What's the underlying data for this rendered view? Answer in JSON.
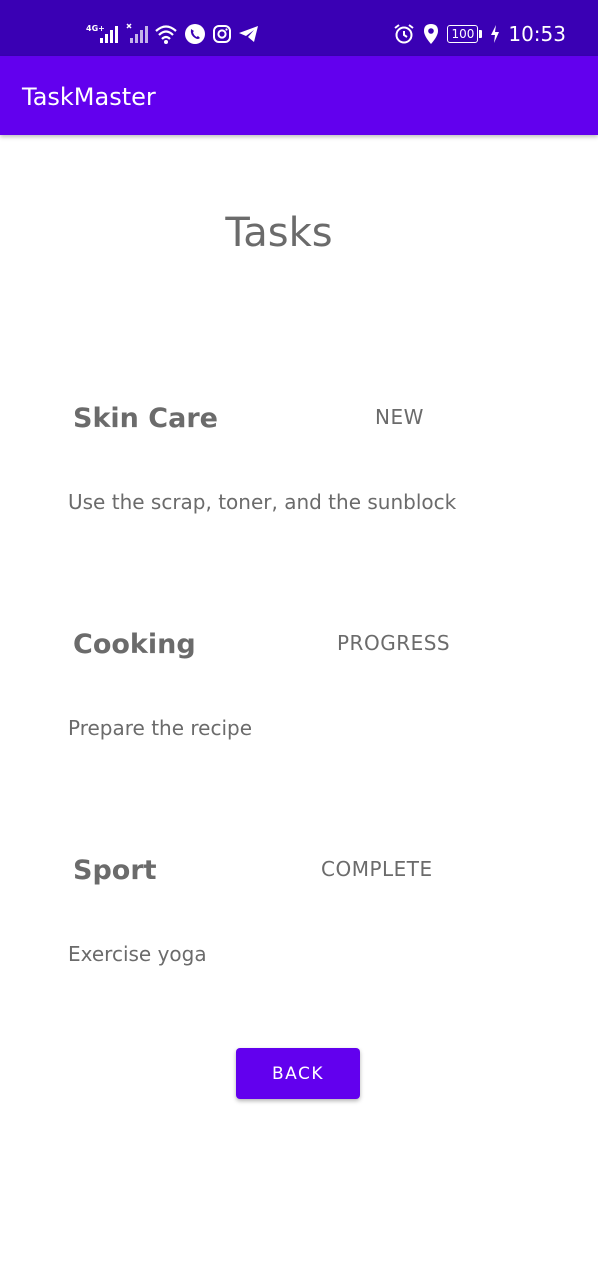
{
  "status_bar": {
    "network_label": "4G+",
    "time": "10:53",
    "battery": "100",
    "icons": [
      "signal-4g-icon",
      "signal-icon",
      "wifi-icon",
      "phone-icon",
      "instagram-icon",
      "telegram-icon",
      "alarm-icon",
      "location-icon",
      "battery-icon",
      "charging-icon"
    ]
  },
  "app_bar": {
    "title": "TaskMaster",
    "color": "#6200ee"
  },
  "page": {
    "title": "Tasks"
  },
  "tasks": [
    {
      "name": "Skin Care",
      "status": "NEW",
      "description": "Use the scrap, toner, and the sunblock"
    },
    {
      "name": "Cooking",
      "status": "PROGRESS",
      "description": "Prepare the recipe"
    },
    {
      "name": "Sport",
      "status": "COMPLETE",
      "description": "Exercise yoga"
    }
  ],
  "back_button": {
    "label": "BACK"
  },
  "colors": {
    "status_bar": "#3a00b4",
    "primary": "#6200ee",
    "text": "#6b6b6b",
    "background": "#ffffff"
  }
}
